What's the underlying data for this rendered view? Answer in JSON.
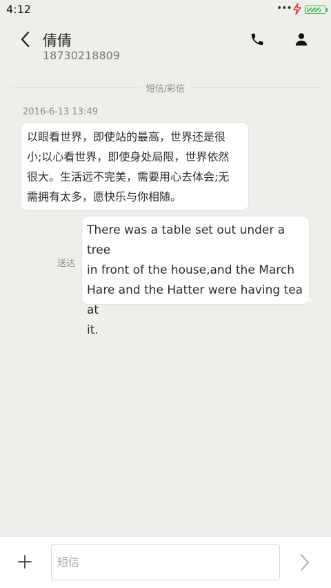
{
  "status_bar": {
    "time": "4:12",
    "dots": "•••",
    "battery_level": 0.9
  },
  "header": {
    "contact_name": "倩倩",
    "contact_number": "18730218809"
  },
  "thread": {
    "divider_label": "短信/彩信",
    "timestamp": "2016-6-13 13:49",
    "messages": [
      {
        "direction": "incoming",
        "lines": [
          "以眼看世界，即使站的最高，世界还是很",
          "小;以心看世界，即使身处局限，世界依然",
          "很大。生活远不完美，需要用心去体会;无",
          "需拥有太多，愿快乐与你相随。"
        ]
      },
      {
        "direction": "outgoing",
        "status": "送达",
        "lines": [
          "There was a table set out under a tree",
          "in front of the house,and the March",
          "Hare and the Hatter were having tea at",
          "it."
        ]
      }
    ]
  },
  "composer": {
    "placeholder": "短信",
    "value": ""
  },
  "icons": {
    "back": "chevron-left-icon",
    "call": "phone-icon",
    "contact": "person-icon",
    "add": "plus-icon",
    "send": "chevron-right-icon"
  },
  "colors": {
    "background": "#eeeeea",
    "bubble": "#ffffff",
    "battery": "#39b54a",
    "charging_bolt": "#e53935"
  }
}
